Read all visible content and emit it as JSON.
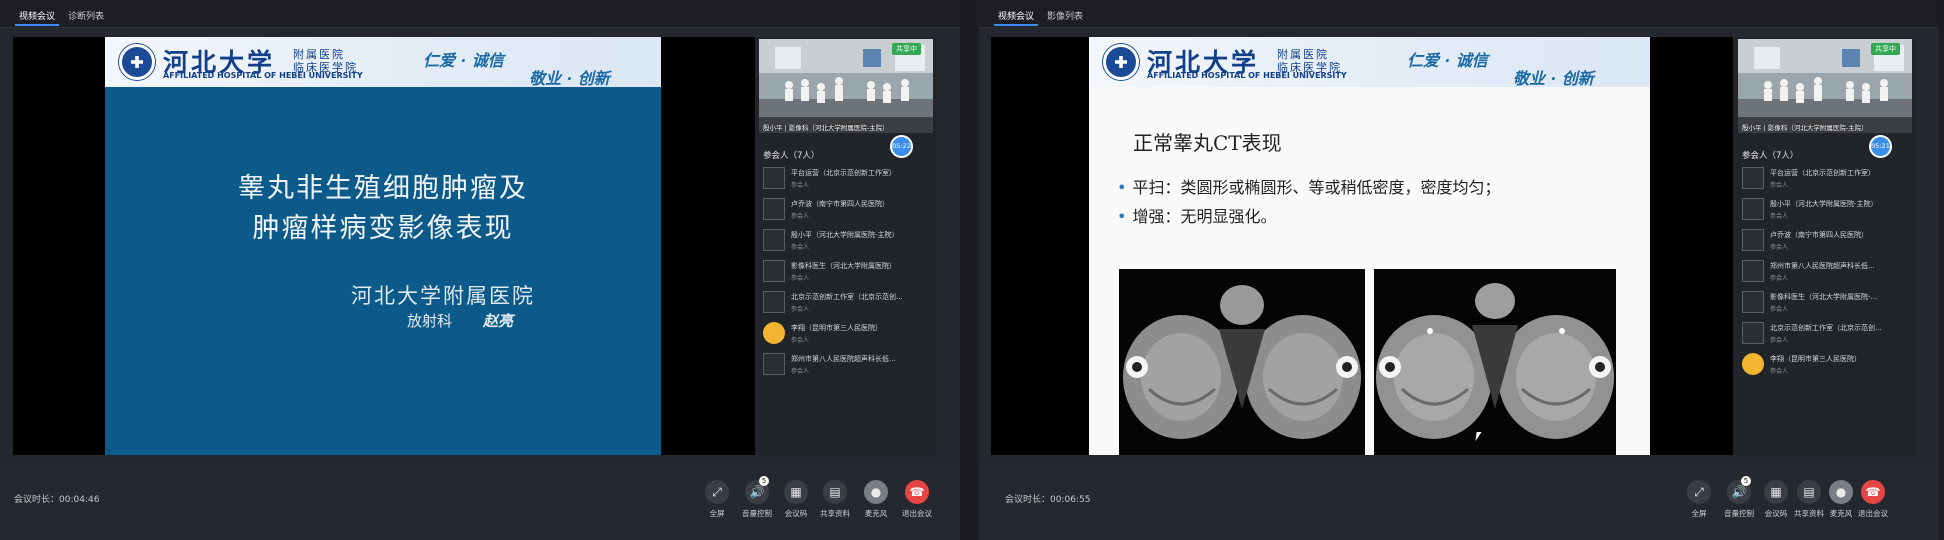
{
  "windows": [
    {
      "tabs": [
        "视频会议",
        "诊断列表"
      ],
      "slide": {
        "type": "title",
        "header": {
          "name": "河北大学",
          "sub1": "附属医院",
          "sub2": "临床医学院",
          "english": "AFFILIATED HOSPITAL OF HEBEI UNIVERSITY",
          "motto1": "仁爱 · 诚信",
          "motto2": "敬业 · 创新"
        },
        "title_line1": "睾丸非生殖细胞肿瘤及",
        "title_line2": "肿瘤样病变影像表现",
        "hospital": "河北大学附属医院",
        "department": "放射科",
        "presenter": "赵亮"
      },
      "panel": {
        "share_badge": "共享中",
        "thumb_name": "殷小平 | 影像科（河北大学附属医院-主院）",
        "timer": "05:22",
        "participants_header": "参会人（7人）",
        "participants": [
          {
            "name": "平台运营（北京示范创新工作室）",
            "role": "参会人"
          },
          {
            "name": "卢乔波（南宁市第四人民医院）",
            "role": "参会人"
          },
          {
            "name": "殷小平（河北大学附属医院-主院）",
            "role": "参会人"
          },
          {
            "name": "影像科医生（河北大学附属医院）",
            "role": "参会人"
          },
          {
            "name": "北京示范创新工作室（北京示范创...",
            "role": "参会人"
          },
          {
            "name": "李翔（昆明市第三人民医院）",
            "role": "参会人"
          },
          {
            "name": "郑州市第八人民医院超声科长低...",
            "role": "参会人"
          }
        ]
      },
      "duration": "会议时长：00:04:46",
      "controls": [
        "全屏",
        "音量控制",
        "会议码",
        "共享资料",
        "麦克风",
        "退出会议"
      ],
      "volume_badge": "5"
    },
    {
      "tabs": [
        "视频会议",
        "影像列表"
      ],
      "slide": {
        "type": "content",
        "header": {
          "name": "河北大学",
          "sub1": "附属医院",
          "sub2": "临床医学院",
          "english": "AFFILIATED HOSPITAL OF HEBEI UNIVERSITY",
          "motto1": "仁爱 · 诚信",
          "motto2": "敬业 · 创新"
        },
        "title": "正常睾丸CT表现",
        "bullet1": "平扫：类圆形或椭圆形、等或稍低密度，密度均匀；",
        "bullet2": "增强：无明显强化。"
      },
      "panel": {
        "share_badge": "共享中",
        "thumb_name": "殷小平 | 影像科（河北大学附属医院-主院）",
        "timer": "05:21",
        "participants_header": "参会人（7人）",
        "participants": [
          {
            "name": "平台运营（北京示范创新工作室）",
            "role": "参会人"
          },
          {
            "name": "殷小平（河北大学附属医院-主院）",
            "role": "参会人"
          },
          {
            "name": "卢乔波（南宁市第四人民医院）",
            "role": "参会人"
          },
          {
            "name": "郑州市第八人民医院超声科长低...",
            "role": "参会人"
          },
          {
            "name": "影像科医生（河北大学附属医院-...",
            "role": "参会人"
          },
          {
            "name": "北京示范创新工作室（北京示范创...",
            "role": "参会人"
          },
          {
            "name": "李翔（昆明市第三人民医院）",
            "role": "参会人"
          }
        ]
      },
      "duration": "会议时长：00:06:55",
      "controls": [
        "全屏",
        "音量控制",
        "会议码",
        "共享资料",
        "麦克风",
        "退出会议"
      ],
      "volume_badge": "5"
    }
  ],
  "colors": {
    "accent": "#3d8bfd",
    "end_call": "#e54545",
    "share_badge": "#32a852",
    "slide_blue": "#0c5a8a"
  },
  "icons": [
    "fullscreen-icon",
    "speaker-icon",
    "qrcode-icon",
    "document-icon",
    "microphone-icon",
    "hangup-icon"
  ]
}
